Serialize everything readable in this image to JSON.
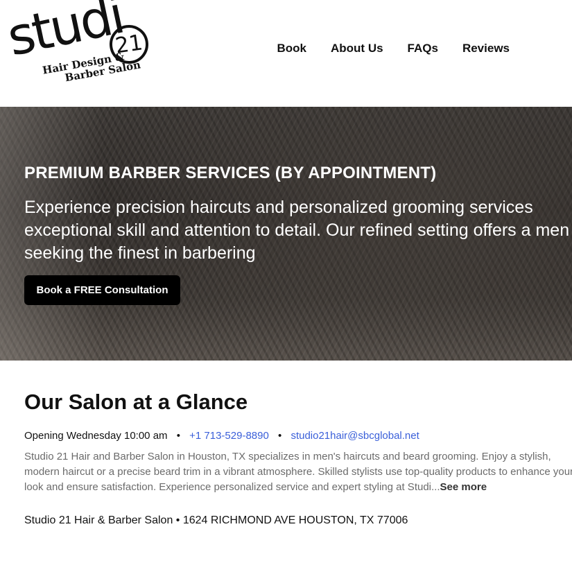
{
  "logo": {
    "main": "studi",
    "number": "21",
    "tagline_1": "Hair Design &",
    "tagline_2": "Barber Salon"
  },
  "nav": {
    "items": [
      "Book",
      "About Us",
      "FAQs",
      "Reviews"
    ]
  },
  "hero": {
    "title": "PREMIUM BARBER SERVICES (BY APPOINTMENT)",
    "description": "Experience precision haircuts and personalized grooming services exceptional skill and attention to detail. Our refined setting offers a men seeking the finest in barbering",
    "button_label": "Book a FREE Consultation"
  },
  "glance": {
    "title": "Our Salon at a Glance",
    "opening": "Opening Wednesday 10:00 am",
    "separator": "•",
    "phone": "+1 713-529-8890",
    "email": "studio21hair@sbcglobal.net",
    "about_text": "Studio 21 Hair and Barber Salon in Houston, TX specializes in men's haircuts and beard grooming. Enjoy a stylish, modern haircut or a precise beard trim in a vibrant atmosphere. Skilled stylists use top-quality products to enhance your look and ensure satisfaction. Experience personalized service and expert styling at Studi...",
    "see_more": "See more",
    "address": "Studio 21 Hair & Barber Salon • 1624 RICHMOND AVE HOUSTON, TX 77006"
  },
  "colors": {
    "link": "#3a5fd9",
    "button_bg": "#000000",
    "text": "#111111",
    "muted_text": "#6b6b6b"
  }
}
